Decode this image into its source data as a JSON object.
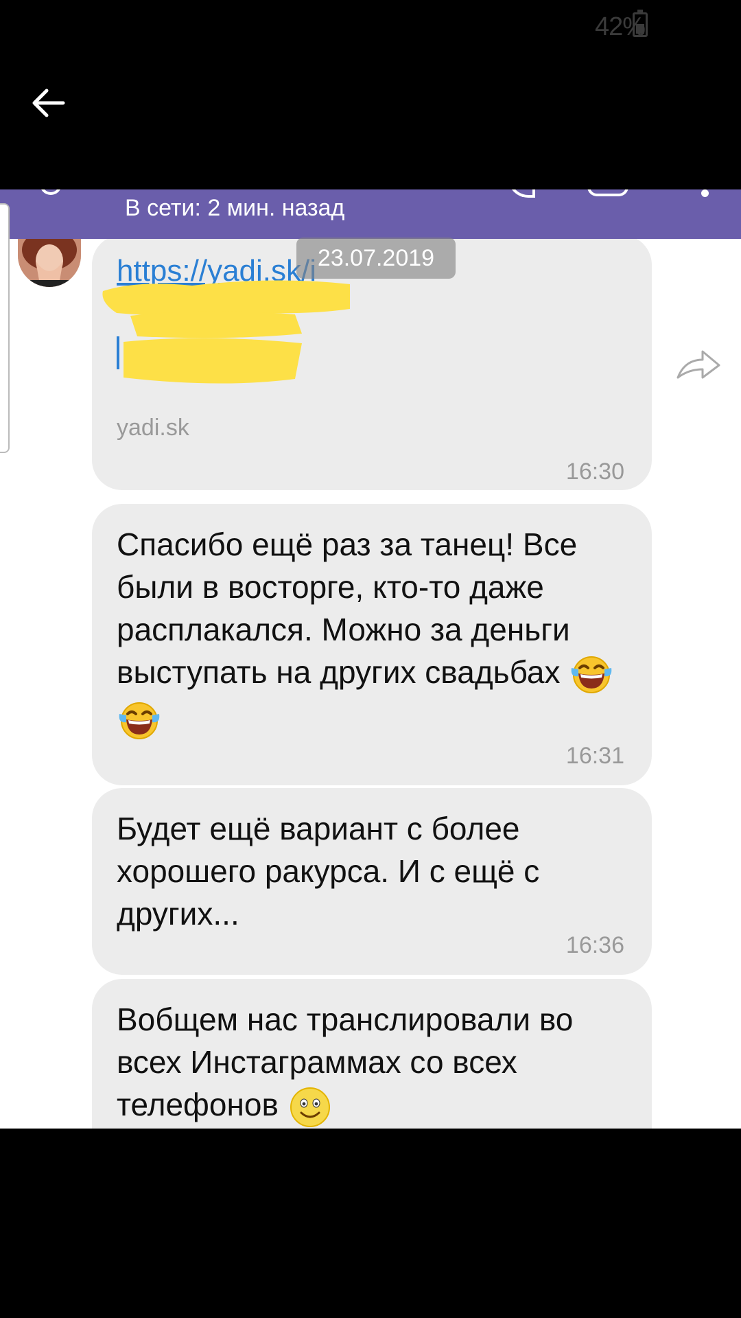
{
  "status_bar": {
    "battery_text": "42%"
  },
  "header": {
    "subtitle": "В сети: 2 мин. назад"
  },
  "date_divider": "23.07.2019",
  "messages": [
    {
      "link": "https://yadi.sk/i",
      "domain": "yadi.sk",
      "time": "16:30"
    },
    {
      "text": "Спасибо ещё раз за танец! Все были в восторге, кто-то даже расплакался. Можно за деньги выступать на других свадьбах",
      "emojis": [
        "tears-of-joy-emoji",
        "tears-of-joy-emoji"
      ],
      "time": "16:31"
    },
    {
      "text": "Будет ещё вариант с более хорошего ракурса. И с ещё с других...",
      "time": "16:36"
    },
    {
      "text": "Вобщем нас транслировали во всех Инстаграммах со всех телефонов",
      "emojis": [
        "smiling-face-emoji"
      ]
    }
  ],
  "icons": [
    "back-arrow-icon",
    "battery-icon",
    "forward-icon"
  ],
  "colors": {
    "header": "#6a5eab",
    "bubble": "#ececec",
    "link": "#2a7fd4",
    "redaction": "#fde047"
  }
}
